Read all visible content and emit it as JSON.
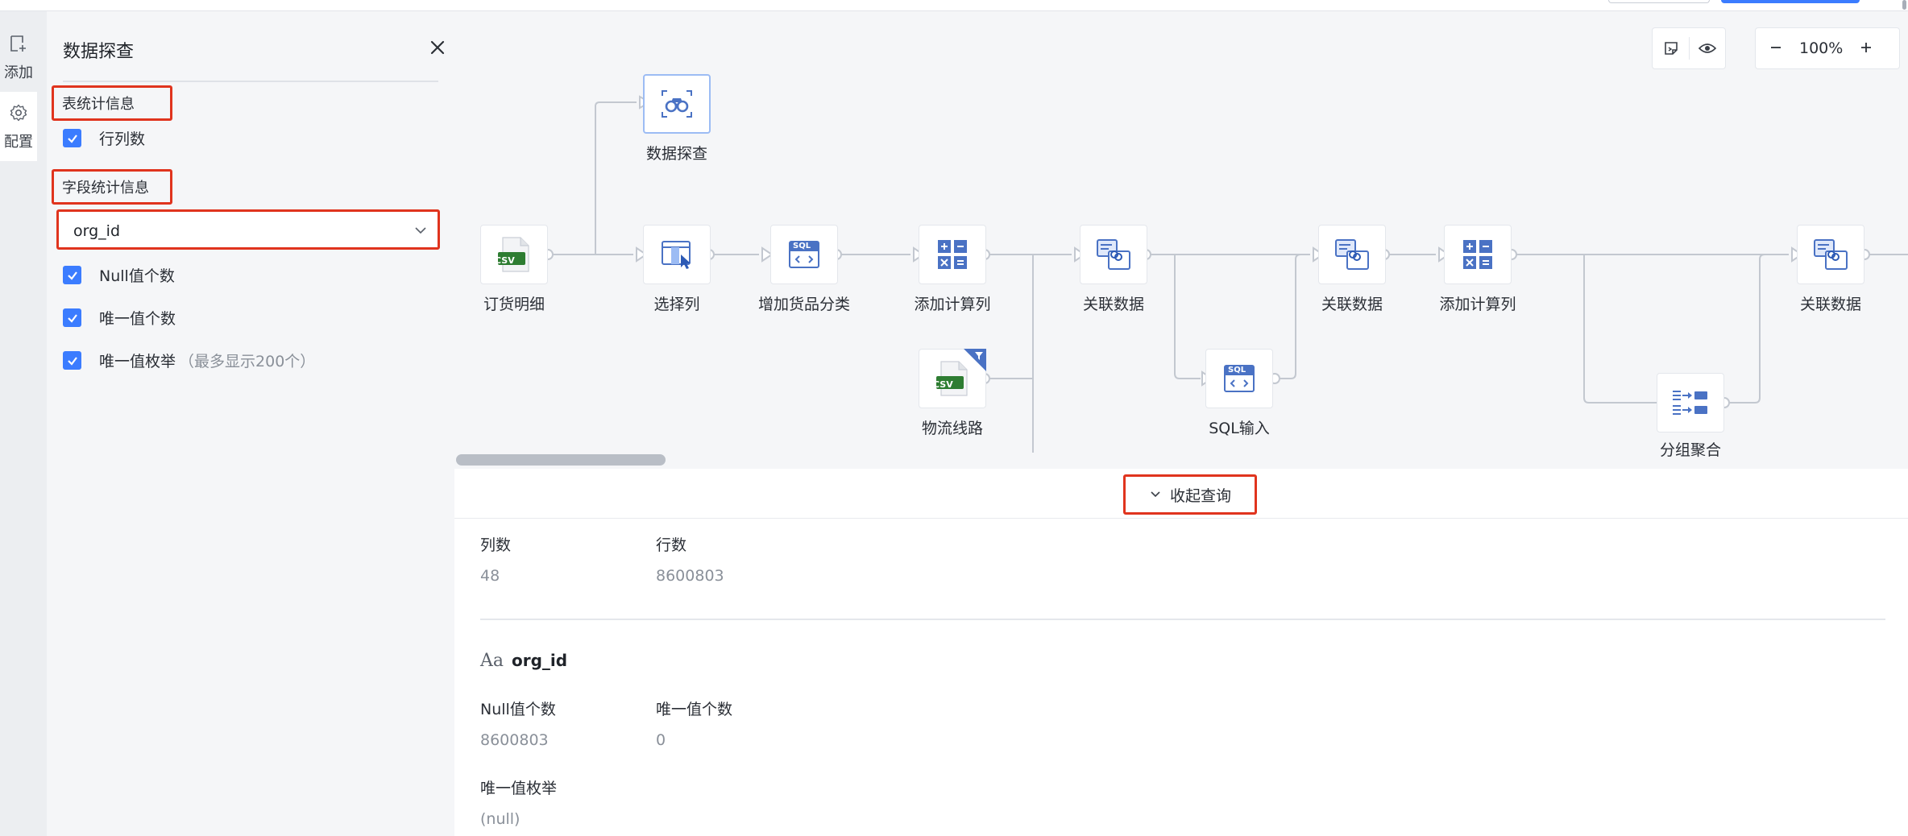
{
  "rail": {
    "add_label": "添加",
    "config_label": "配置"
  },
  "panel": {
    "title": "数据探查",
    "table_stats_title": "表统计信息",
    "row_col_label": "行列数",
    "field_stats_title": "字段统计信息",
    "selected_field": "org_id",
    "null_count_label": "Null值个数",
    "unique_count_label": "唯一值个数",
    "unique_enum_label": "唯一值枚举",
    "unique_enum_note": "（最多显示200个）"
  },
  "canvas": {
    "zoom": "100%",
    "nodes": [
      {
        "id": "explore",
        "label": "数据探查",
        "icon": "binoculars-icon"
      },
      {
        "id": "order",
        "label": "订货明细",
        "icon": "csv-file-icon"
      },
      {
        "id": "select",
        "label": "选择列",
        "icon": "select-column-icon"
      },
      {
        "id": "sql1",
        "label": "增加货品分类",
        "icon": "sql-icon"
      },
      {
        "id": "calc1",
        "label": "添加计算列",
        "icon": "calculator-icon"
      },
      {
        "id": "join1",
        "label": "关联数据",
        "icon": "join-icon"
      },
      {
        "id": "logistics",
        "label": "物流线路",
        "icon": "csv-file-icon"
      },
      {
        "id": "sql2",
        "label": "SQL输入",
        "icon": "sql-icon"
      },
      {
        "id": "join2",
        "label": "关联数据",
        "icon": "join-icon"
      },
      {
        "id": "calc2",
        "label": "添加计算列",
        "icon": "calculator-icon"
      },
      {
        "id": "group",
        "label": "分组聚合",
        "icon": "group-aggregate-icon"
      },
      {
        "id": "join3",
        "label": "关联数据",
        "icon": "join-icon"
      }
    ],
    "csv_badge": "CSV",
    "sql_badge": "SQL"
  },
  "results": {
    "collapse_label": "收起查询",
    "col_count_label": "列数",
    "col_count_value": "48",
    "row_count_label": "行数",
    "row_count_value": "8600803",
    "field_type_glyph": "Aa",
    "field_name": "org_id",
    "null_count_label": "Null值个数",
    "null_count_value": "8600803",
    "unique_count_label": "唯一值个数",
    "unique_count_value": "0",
    "unique_enum_label": "唯一值枚举",
    "unique_enum_value": "(null)"
  },
  "colors": {
    "accent": "#3b7cff",
    "highlight_box": "#e0341e",
    "csv_green": "#2e7d32",
    "icon_blue": "#4a72c4"
  }
}
